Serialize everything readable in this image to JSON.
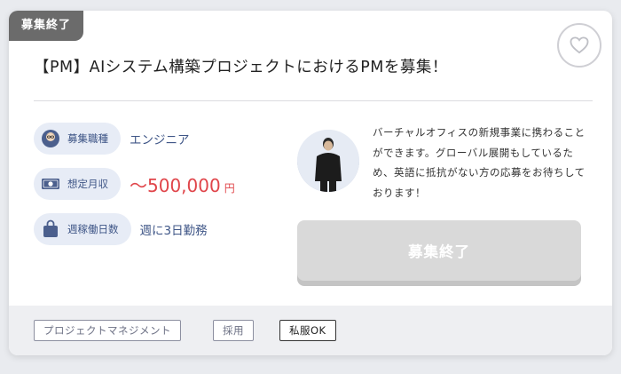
{
  "status_tag": "募集終了",
  "title": "【PM】AIシステム構築プロジェクトにおけるPMを募集！",
  "specs": [
    {
      "label": "募集職種",
      "value": "エンジニア",
      "icon": "person-icon"
    },
    {
      "label": "想定月収",
      "value": "〜500,000",
      "unit": "円",
      "icon": "money-icon"
    },
    {
      "label": "週稼働日数",
      "value": "週に3日勤務",
      "icon": "bag-icon"
    }
  ],
  "description": "バーチャルオフィスの新規事業に携わることができます。グローバル展開もしているため、英語に抵抗がない方の応募をお待ちしております！",
  "apply_button": "募集終了",
  "tags": [
    "プロジェクトマネジメント",
    "採用",
    "私服OK"
  ],
  "colors": {
    "accent": "#3f5687",
    "salary": "#e0454a",
    "disabled": "#d9d9d9"
  }
}
